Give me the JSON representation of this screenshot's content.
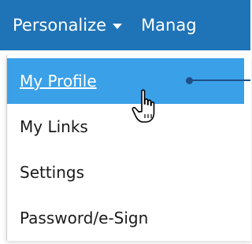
{
  "navbar": {
    "items": [
      {
        "label": "Personalize"
      },
      {
        "label": "Manag"
      }
    ]
  },
  "dropdown": {
    "items": [
      {
        "label": "My Profile",
        "state": "hover"
      },
      {
        "label": "My Links"
      },
      {
        "label": "Settings"
      },
      {
        "label": "Password/e-Sign"
      }
    ]
  },
  "colors": {
    "navbar_bg": "#1f73b7",
    "active_item_bg": "#3aa0e8",
    "callout_line": "#1f4f86"
  },
  "icons": {
    "nav_caret": "caret-down-icon",
    "cursor": "hand-pointer-icon"
  }
}
